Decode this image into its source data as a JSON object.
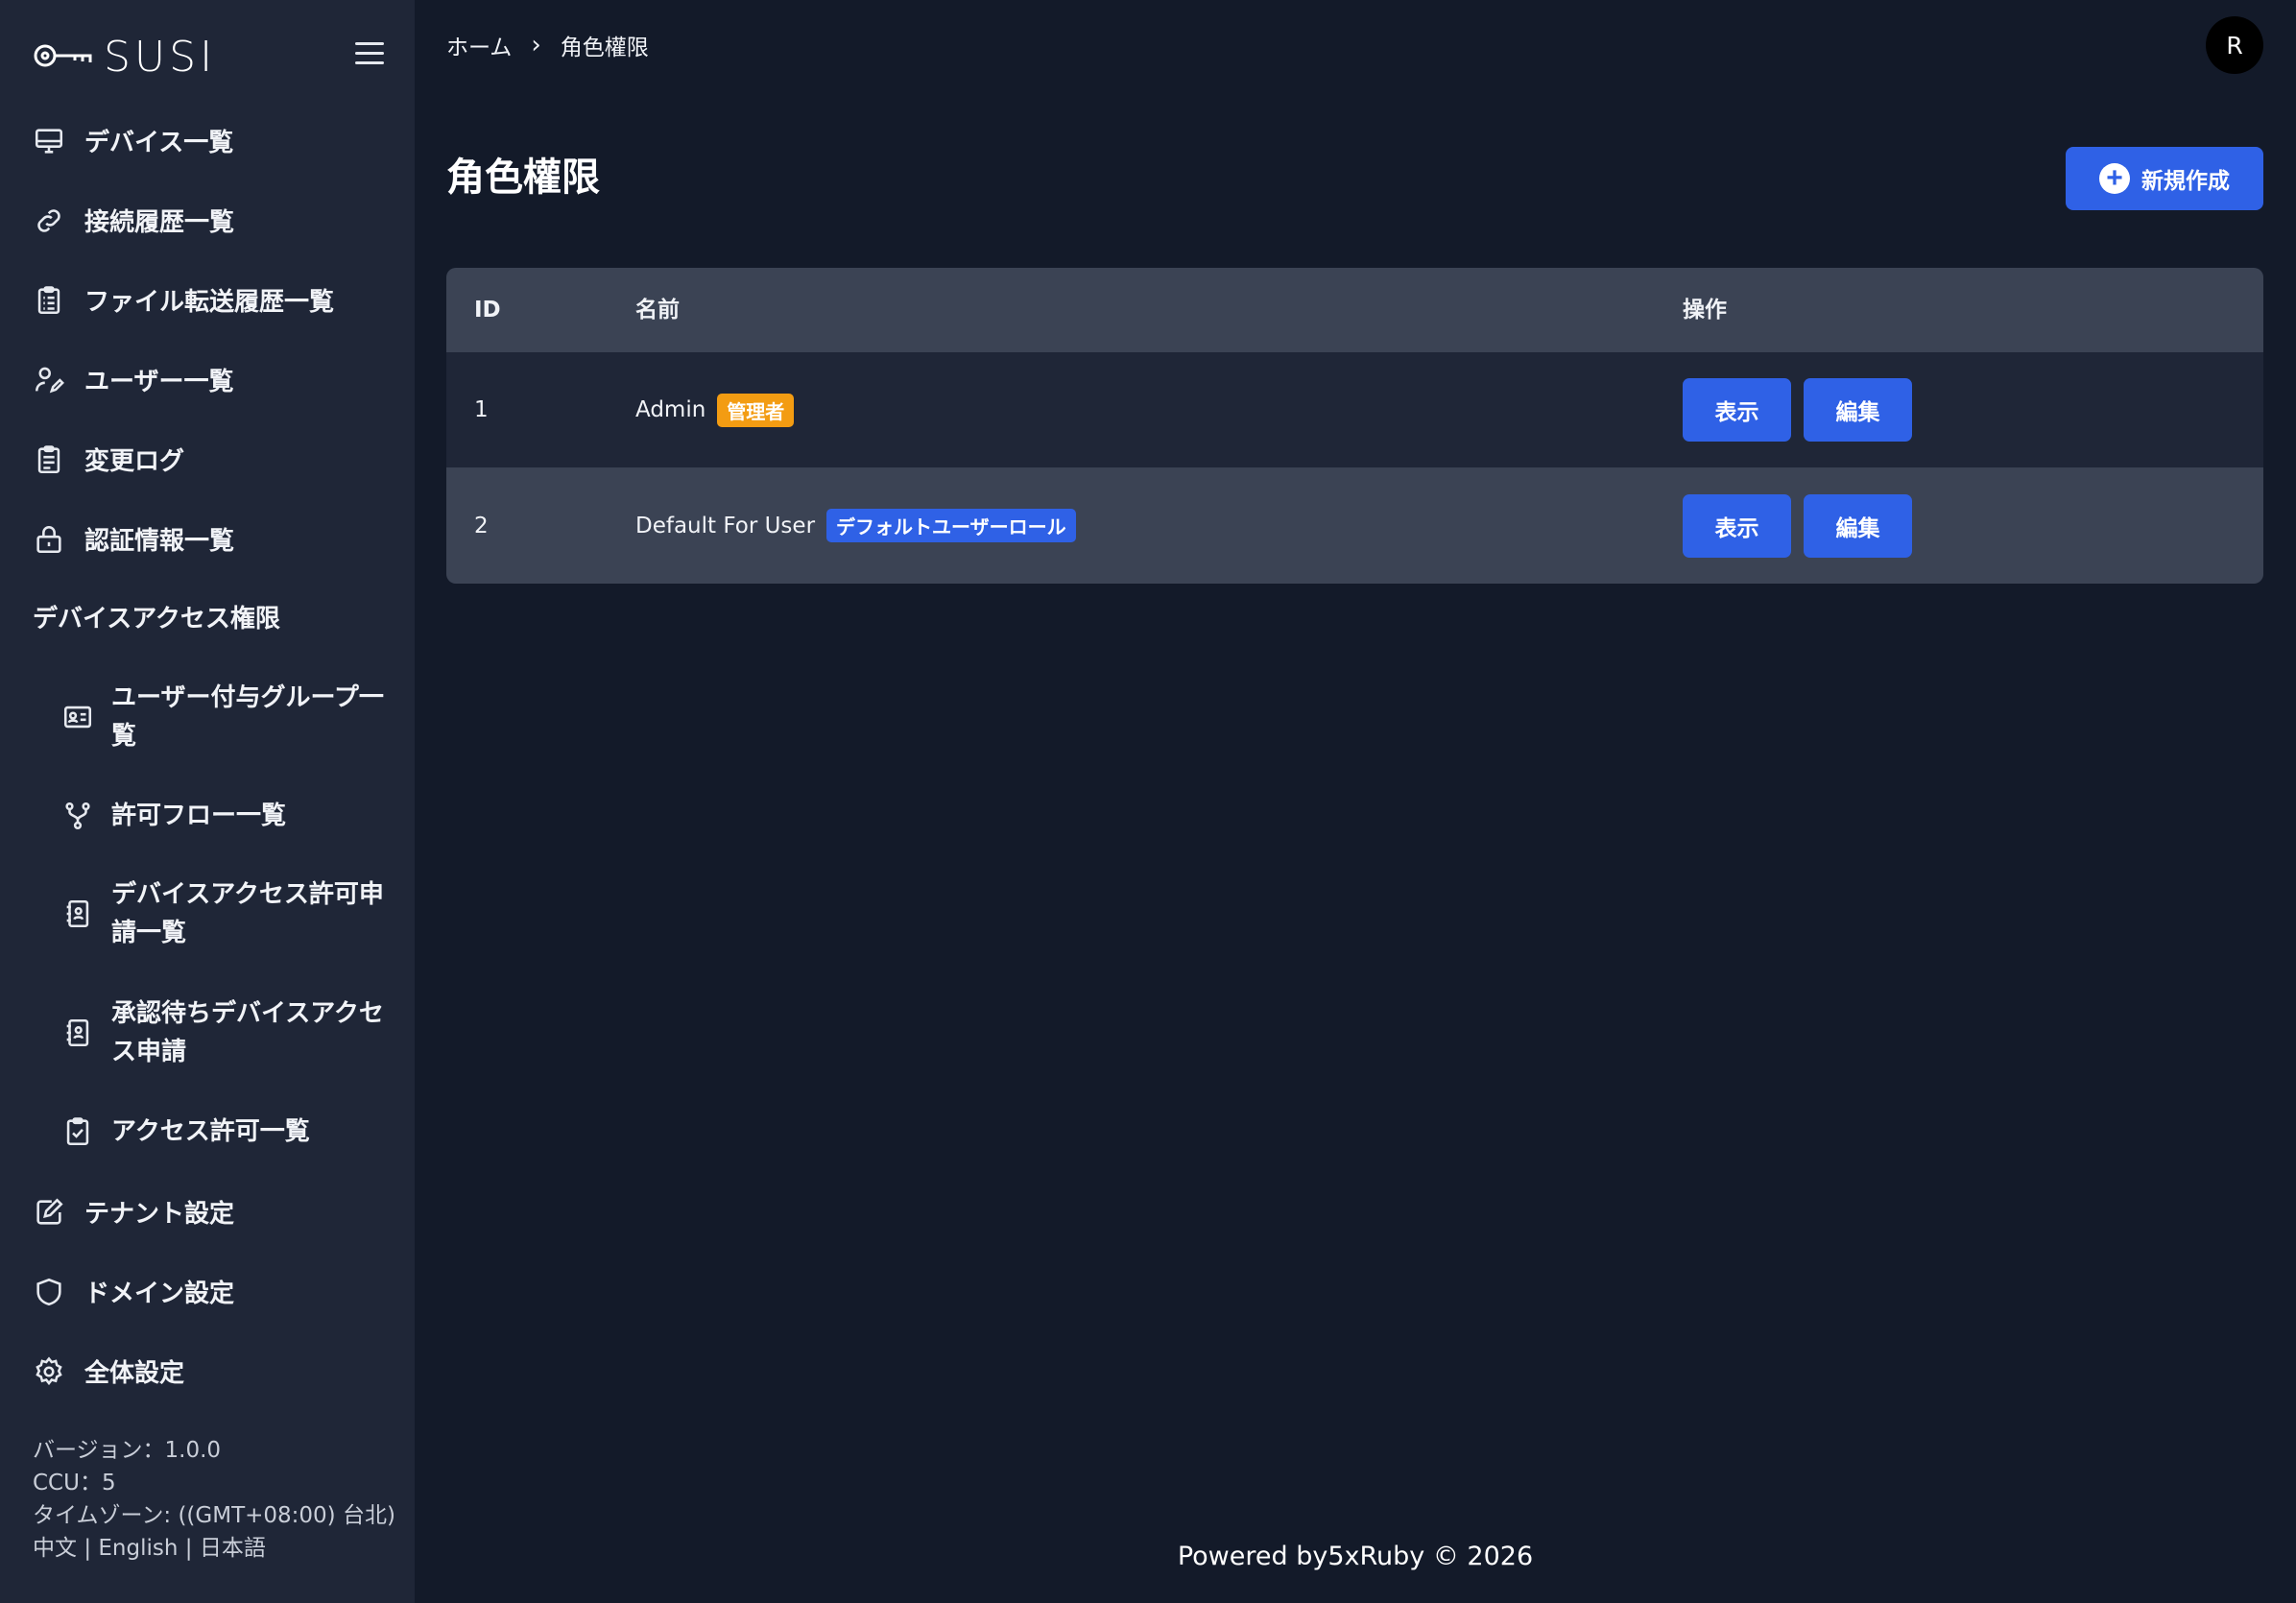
{
  "brand": {
    "name": "SUSI"
  },
  "sidebar": {
    "items": [
      {
        "label": "デバイス一覧",
        "icon": "monitor-icon"
      },
      {
        "label": "接続履歴一覧",
        "icon": "link-icon"
      },
      {
        "label": "ファイル転送履歴一覧",
        "icon": "clipboard-list-icon"
      },
      {
        "label": "ユーザー一覧",
        "icon": "user-edit-icon"
      },
      {
        "label": "変更ログ",
        "icon": "clipboard-icon"
      },
      {
        "label": "認証情報一覧",
        "icon": "lock-icon"
      }
    ],
    "section_title": "デバイスアクセス権限",
    "sub_items": [
      {
        "label": "ユーザー付与グループ一覧",
        "icon": "id-card-icon"
      },
      {
        "label": "許可フロー一覧",
        "icon": "branch-icon"
      },
      {
        "label": "デバイスアクセス許可申請一覧",
        "icon": "contact-book-icon"
      },
      {
        "label": "承認待ちデバイスアクセス申請",
        "icon": "contact-book-icon"
      },
      {
        "label": "アクセス許可一覧",
        "icon": "clipboard-check-icon"
      }
    ],
    "bottom_items": [
      {
        "label": "テナント設定",
        "icon": "edit-note-icon"
      },
      {
        "label": "ドメイン設定",
        "icon": "shield-icon"
      },
      {
        "label": "全体設定",
        "icon": "gear-icon"
      }
    ],
    "meta": {
      "version": "バージョン：1.0.0",
      "ccu": "CCU：5",
      "timezone": "タイムゾーン: ((GMT+08:00) 台北)",
      "lang_zh": "中文",
      "lang_en": "English",
      "lang_ja": "日本語",
      "sep": "|"
    }
  },
  "breadcrumb": {
    "home": "ホーム",
    "current": "角色權限"
  },
  "user": {
    "avatar_initial": "R"
  },
  "page": {
    "title": "角色權限",
    "new_button": "新規作成"
  },
  "table": {
    "headers": {
      "id": "ID",
      "name": "名前",
      "actions": "操作"
    },
    "rows": [
      {
        "id": "1",
        "name": "Admin",
        "badge": "管理者",
        "badge_color": "#f39c12"
      },
      {
        "id": "2",
        "name": "Default For User",
        "badge": "デフォルトユーザーロール",
        "badge_color": "#2f61e6"
      }
    ],
    "show_label": "表示",
    "edit_label": "編集"
  },
  "footer": {
    "text": "Powered by5xRuby © 2026"
  },
  "colors": {
    "accent": "#2f61e6",
    "sidebar_bg": "#1f2637",
    "main_bg": "#131a29",
    "badge_orange": "#f39c12"
  }
}
